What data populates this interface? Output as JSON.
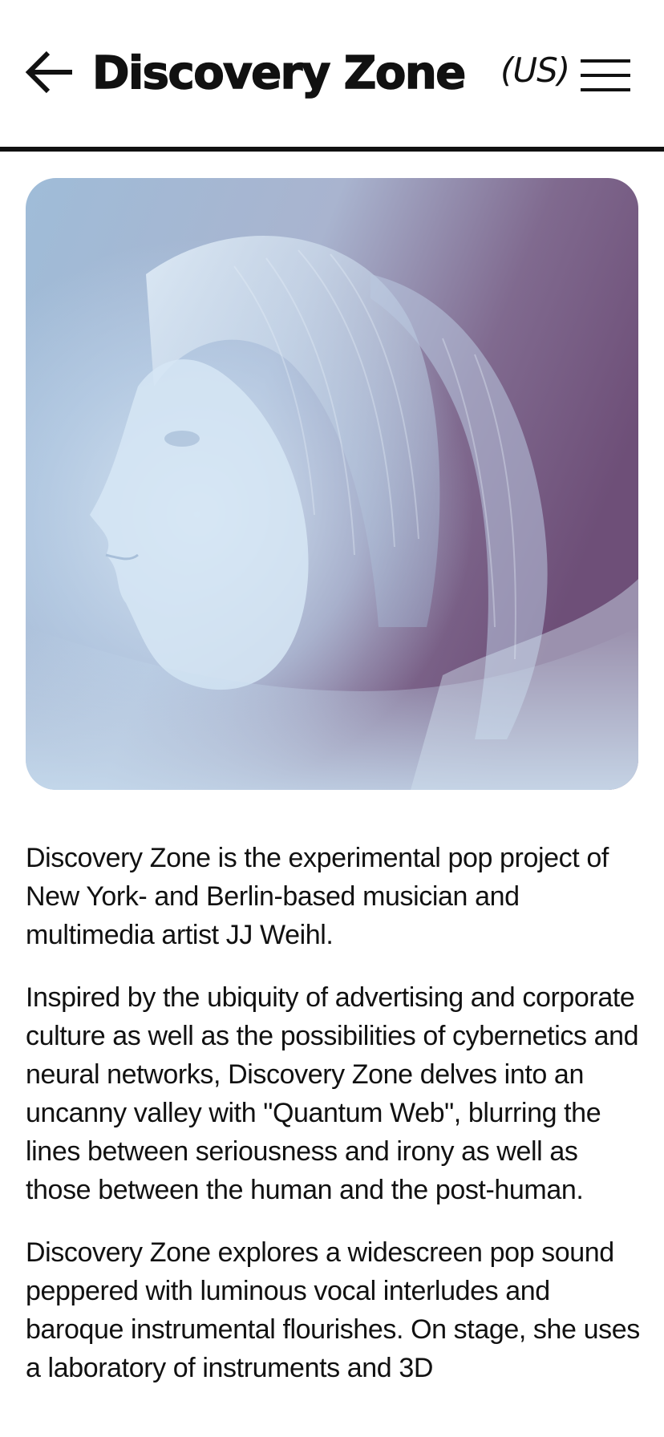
{
  "header": {
    "back_icon": "arrow-left-icon",
    "title": "Discovery Zone",
    "region": "(US)",
    "menu_icon": "hamburger-menu-icon"
  },
  "hero": {
    "alt": "Discovery Zone portrait",
    "colors": {
      "light": "#c9dff0",
      "mid": "#9bb8d6",
      "dark": "#6e4f78"
    }
  },
  "content": {
    "paragraphs": [
      "Discovery Zone is the experimental pop project of New York- and Berlin-based musician and multimedia artist JJ Weihl.",
      "Inspired by the ubiquity of advertising and corporate culture as well as the possibilities of cybernetics and neural networks, Discovery Zone delves into an uncanny valley with \"Quantum Web\", blurring the lines between seriousness and irony as well as those between the human and the post-human.",
      "Discovery Zone explores a widescreen pop sound peppered with luminous vocal interludes and baroque instrumental flourishes. On stage, she uses a laboratory of instruments and 3D"
    ]
  }
}
